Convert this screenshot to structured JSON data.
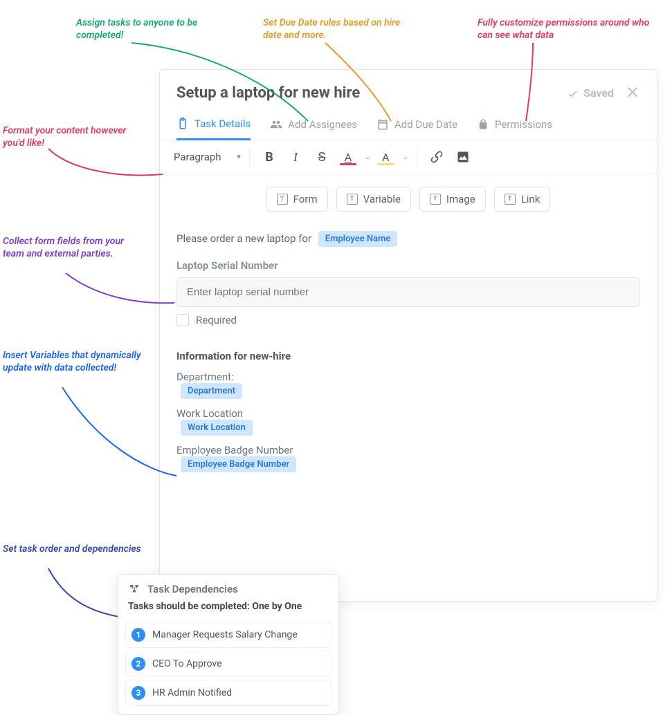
{
  "annotations": {
    "assign": "Assign tasks to anyone to be completed!",
    "due": "Set Due Date rules based on hire date and more.",
    "perm": "Fully customize permissions around who can see what data",
    "format": "Format your content however you'd like!",
    "forms": "Collect form fields from your team and external parties.",
    "vars": "Insert Variables that dynamically update with data collected!",
    "deps": "Set task order and dependencies"
  },
  "card": {
    "title": "Setup a laptop for new hire",
    "saved_label": "Saved"
  },
  "tabs": {
    "details": "Task Details",
    "assignees": "Add Assignees",
    "due_date": "Add Due Date",
    "permissions": "Permissions"
  },
  "toolbar": {
    "style": "Paragraph"
  },
  "insert_buttons": {
    "form": "Form",
    "variable": "Variable",
    "image": "Image",
    "link": "Link"
  },
  "editor": {
    "sentence_prefix": "Please order a new laptop for",
    "employee_name_var": "Employee Name",
    "serial_label": "Laptop Serial Number",
    "serial_placeholder": "Enter laptop serial number",
    "required_label": "Required",
    "section_head": "Information for new-hire",
    "dept_label": "Department:",
    "dept_var": "Department",
    "loc_label": "Work Location",
    "loc_var": "Work Location",
    "badge_label": "Employee Badge Number",
    "badge_var": "Employee Badge Number"
  },
  "deps": {
    "title": "Task Dependencies",
    "subtitle": "Tasks should be completed: One by One",
    "items": [
      {
        "n": "1",
        "label": "Manager Requests Salary Change"
      },
      {
        "n": "2",
        "label": "CEO To Approve"
      },
      {
        "n": "3",
        "label": "HR Admin Notified"
      }
    ]
  }
}
